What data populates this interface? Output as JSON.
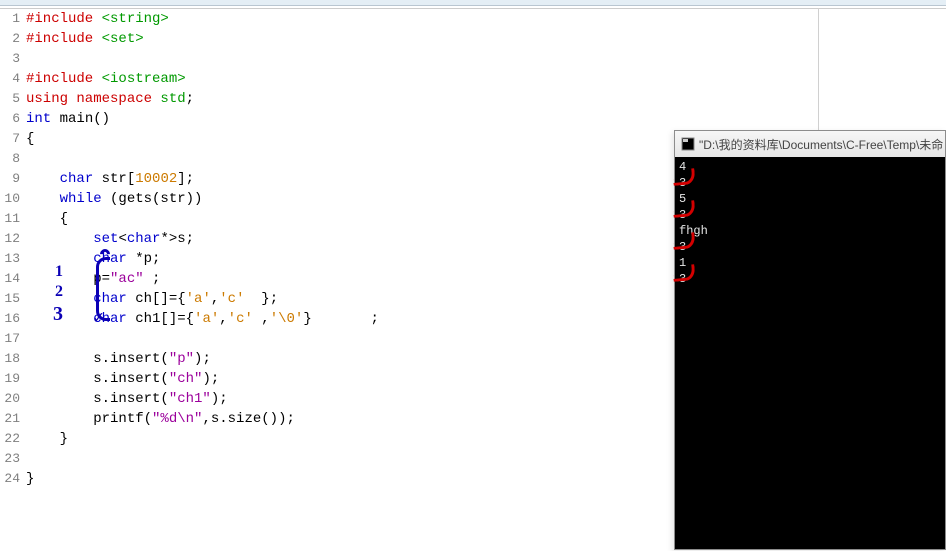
{
  "editor": {
    "lines": [
      {
        "ln": "1",
        "tokens": [
          {
            "cls": "kw-pp",
            "t": "#include "
          },
          {
            "cls": "kw-green",
            "t": "<string>"
          }
        ]
      },
      {
        "ln": "2",
        "tokens": [
          {
            "cls": "kw-pp",
            "t": "#include "
          },
          {
            "cls": "kw-green",
            "t": "<set>"
          }
        ]
      },
      {
        "ln": "3",
        "tokens": []
      },
      {
        "ln": "4",
        "tokens": [
          {
            "cls": "kw-pp",
            "t": "#include "
          },
          {
            "cls": "kw-green",
            "t": "<iostream>"
          }
        ]
      },
      {
        "ln": "5",
        "tokens": [
          {
            "cls": "kw-pp",
            "t": "using namespace "
          },
          {
            "cls": "kw-green",
            "t": "std"
          },
          {
            "cls": "kw-plain",
            "t": ";"
          }
        ]
      },
      {
        "ln": "6",
        "tokens": [
          {
            "cls": "kw-blue",
            "t": "int"
          },
          {
            "cls": "kw-plain",
            "t": " main()"
          }
        ]
      },
      {
        "ln": "7",
        "tokens": [
          {
            "cls": "kw-plain",
            "t": "{"
          }
        ]
      },
      {
        "ln": "8",
        "tokens": []
      },
      {
        "ln": "9",
        "tokens": [
          {
            "cls": "kw-plain",
            "t": "    "
          },
          {
            "cls": "kw-blue",
            "t": "char"
          },
          {
            "cls": "kw-plain",
            "t": " str["
          },
          {
            "cls": "kw-num",
            "t": "10002"
          },
          {
            "cls": "kw-plain",
            "t": "];"
          }
        ]
      },
      {
        "ln": "10",
        "tokens": [
          {
            "cls": "kw-plain",
            "t": "    "
          },
          {
            "cls": "kw-blue",
            "t": "while"
          },
          {
            "cls": "kw-plain",
            "t": " (gets(str))"
          }
        ]
      },
      {
        "ln": "11",
        "tokens": [
          {
            "cls": "kw-plain",
            "t": "    {"
          }
        ]
      },
      {
        "ln": "12",
        "tokens": [
          {
            "cls": "kw-plain",
            "t": "        "
          },
          {
            "cls": "kw-blue",
            "t": "set"
          },
          {
            "cls": "kw-plain",
            "t": "<"
          },
          {
            "cls": "kw-blue",
            "t": "char"
          },
          {
            "cls": "kw-plain",
            "t": "*>s;"
          }
        ]
      },
      {
        "ln": "13",
        "tokens": [
          {
            "cls": "kw-plain",
            "t": "        "
          },
          {
            "cls": "kw-blue",
            "t": "char"
          },
          {
            "cls": "kw-plain",
            "t": " *p;"
          }
        ]
      },
      {
        "ln": "14",
        "tokens": [
          {
            "cls": "kw-plain",
            "t": "        p="
          },
          {
            "cls": "kw-str",
            "t": "\"ac\""
          },
          {
            "cls": "kw-plain",
            "t": " ;"
          }
        ]
      },
      {
        "ln": "15",
        "tokens": [
          {
            "cls": "kw-plain",
            "t": "        "
          },
          {
            "cls": "kw-blue",
            "t": "char"
          },
          {
            "cls": "kw-plain",
            "t": " ch[]={"
          },
          {
            "cls": "kw-num",
            "t": "'a'"
          },
          {
            "cls": "kw-plain",
            "t": ","
          },
          {
            "cls": "kw-num",
            "t": "'c'"
          },
          {
            "cls": "kw-plain",
            "t": "  };"
          }
        ]
      },
      {
        "ln": "16",
        "tokens": [
          {
            "cls": "kw-plain",
            "t": "        "
          },
          {
            "cls": "kw-blue",
            "t": "char"
          },
          {
            "cls": "kw-plain",
            "t": " ch1[]={"
          },
          {
            "cls": "kw-num",
            "t": "'a'"
          },
          {
            "cls": "kw-plain",
            "t": ","
          },
          {
            "cls": "kw-num",
            "t": "'c'"
          },
          {
            "cls": "kw-plain",
            "t": " ,"
          },
          {
            "cls": "kw-num",
            "t": "'\\0'"
          },
          {
            "cls": "kw-plain",
            "t": "}       ;"
          }
        ]
      },
      {
        "ln": "17",
        "tokens": []
      },
      {
        "ln": "18",
        "tokens": [
          {
            "cls": "kw-plain",
            "t": "        s.insert("
          },
          {
            "cls": "kw-str",
            "t": "\"p\""
          },
          {
            "cls": "kw-plain",
            "t": ");"
          }
        ]
      },
      {
        "ln": "19",
        "tokens": [
          {
            "cls": "kw-plain",
            "t": "        s.insert("
          },
          {
            "cls": "kw-str",
            "t": "\"ch\""
          },
          {
            "cls": "kw-plain",
            "t": ");"
          }
        ]
      },
      {
        "ln": "20",
        "tokens": [
          {
            "cls": "kw-plain",
            "t": "        s.insert("
          },
          {
            "cls": "kw-str",
            "t": "\"ch1\""
          },
          {
            "cls": "kw-plain",
            "t": ");"
          }
        ]
      },
      {
        "ln": "21",
        "tokens": [
          {
            "cls": "kw-plain",
            "t": "        printf("
          },
          {
            "cls": "kw-str",
            "t": "\"%d\\n\""
          },
          {
            "cls": "kw-plain",
            "t": ",s.size());"
          }
        ]
      },
      {
        "ln": "22",
        "tokens": [
          {
            "cls": "kw-plain",
            "t": "    }"
          }
        ]
      },
      {
        "ln": "23",
        "tokens": []
      },
      {
        "ln": "24",
        "tokens": [
          {
            "cls": "kw-plain",
            "t": "}"
          }
        ]
      }
    ],
    "annotations": {
      "n1": "1",
      "n2": "2",
      "n3": "3"
    }
  },
  "console": {
    "title": "\"D:\\我的资料库\\Documents\\C-Free\\Temp\\未命",
    "output": [
      "4",
      "3",
      "5",
      "3",
      "fhgh",
      "3",
      "1",
      "3"
    ]
  }
}
